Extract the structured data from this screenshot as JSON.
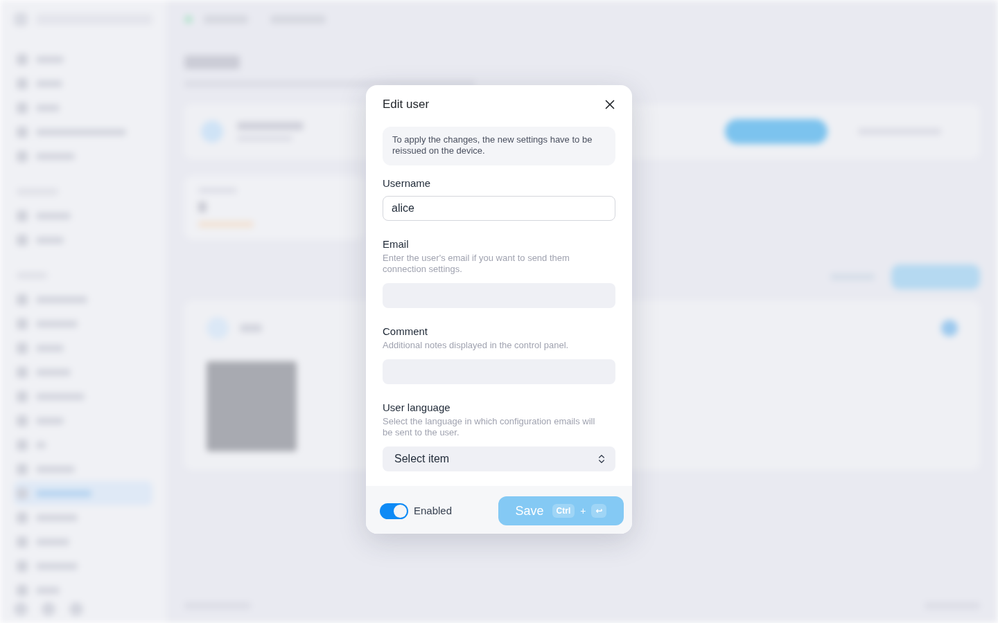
{
  "dialog": {
    "title": "Edit user",
    "notice": "To apply the changes, the new settings have to be reissued on the device.",
    "fields": [
      {
        "kind": "text",
        "label": "Username",
        "value": "alice"
      },
      {
        "kind": "text",
        "label": "Email",
        "hint": "Enter the user's email if you want to send them connection settings."
      },
      {
        "kind": "text",
        "label": "Comment",
        "hint": "Additional notes displayed in the control panel."
      },
      {
        "kind": "select",
        "label": "User language",
        "hint": "Select the language in which configuration emails will be sent to the user.",
        "placeholder": "Select item"
      }
    ],
    "footer": {
      "toggle": {
        "label": "Enabled",
        "on": true
      },
      "save_button": {
        "label": "Save",
        "disabled": true,
        "shortcut": {
          "keys": [
            "Ctrl",
            "↩"
          ],
          "separator": "+"
        }
      }
    }
  }
}
